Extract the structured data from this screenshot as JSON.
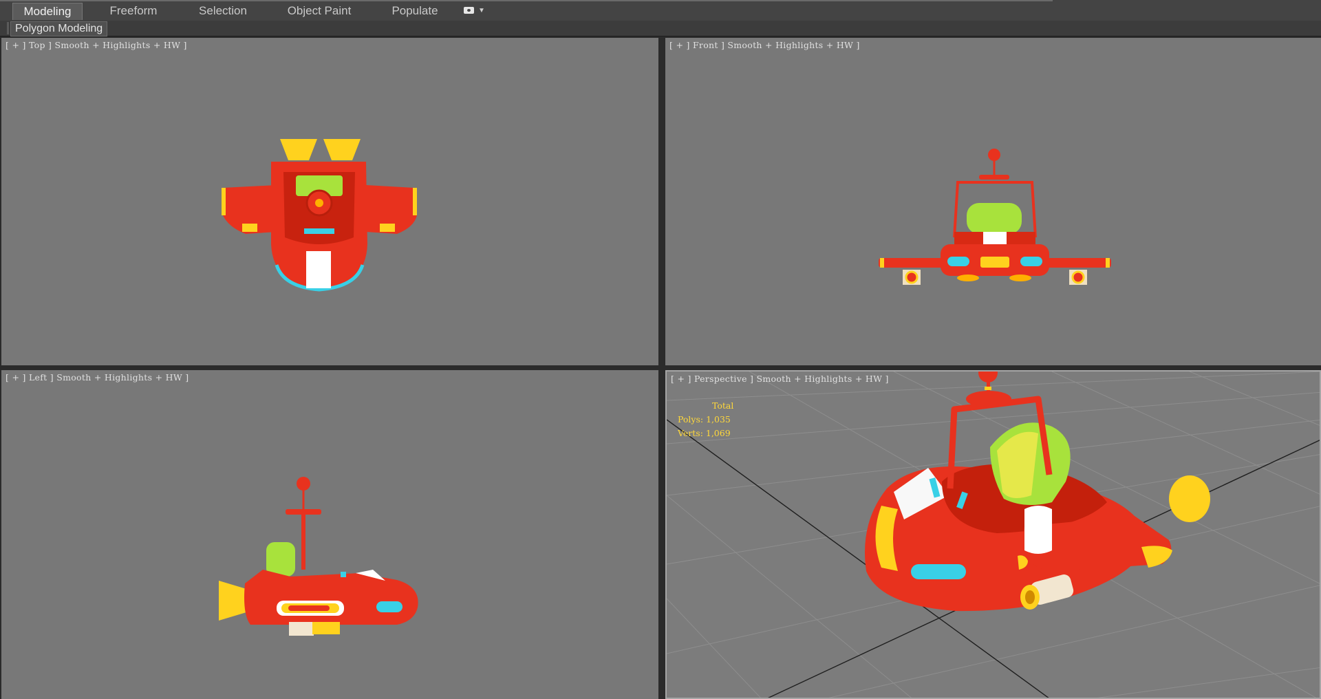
{
  "ribbon": {
    "tabs": [
      "Modeling",
      "Freeform",
      "Selection",
      "Object Paint",
      "Populate"
    ],
    "active_tab": "Modeling",
    "panel_title": "Polygon Modeling"
  },
  "viewports": {
    "top": {
      "label": "[ + ] Top ] Smooth + Highlights + HW ]"
    },
    "front": {
      "label": "[ + ] Front ] Smooth + Highlights + HW ]"
    },
    "left": {
      "label": "[ + ] Left ] Smooth + Highlights + HW ]"
    },
    "perspective": {
      "label": "[ + ] Perspective ] Smooth + Highlights + HW ]"
    }
  },
  "statistics": {
    "total_label": "Total",
    "polys_label": "Polys: 1,035",
    "verts_label": "Verts: 1,069"
  },
  "colors": {
    "viewport_bg": "#787878",
    "model_red": "#e8321e",
    "model_yellow": "#ffd21e",
    "model_green": "#a8e23c",
    "model_cyan": "#39d0e6",
    "stats_text": "#ffd83a"
  }
}
